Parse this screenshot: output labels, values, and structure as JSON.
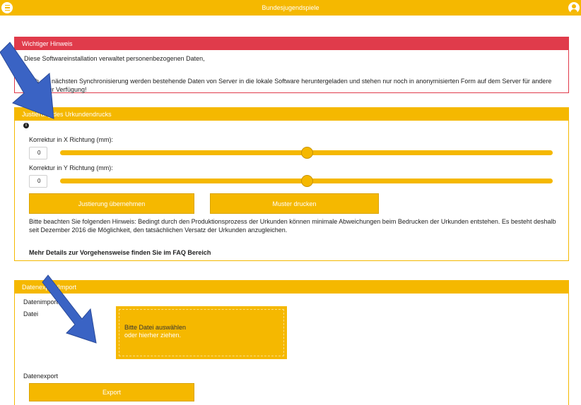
{
  "header": {
    "title": "Bundesjugendspiele"
  },
  "notice": {
    "title": "Wichtiger Hinweis",
    "line1": "Diese Softwareinstallation verwaltet personenbezogenen Daten,",
    "line2": "Nach der nächsten Synchronisierung werden bestehende Daten von Server in die lokale Software heruntergeladen und stehen nur noch in anonymisierten Form auf dem Server für andere Geräte zur Verfügung!"
  },
  "adjustment": {
    "title": "Justierung des Urkundendrucks",
    "x_label": "Korrektur in X Richtung (mm):",
    "x_value": "0",
    "x_slider_fraction": 0.5,
    "y_label": "Korrektur in Y Richtung (mm):",
    "y_value": "0",
    "y_slider_fraction": 0.5,
    "apply_button": "Justierung übernehmen",
    "print_button": "Muster drucken",
    "hint": "Bitte beachten Sie folgenden Hinweis: Bedingt durch den Produktionsprozess der Urkunden können minimale Abweichungen beim Bedrucken der Urkunden entstehen. Es besteht deshalb seit Dezember 2016 die Möglichkeit, den tatsächlichen Versatz der Urkunden anzugleichen.",
    "faq": "Mehr Details zur Vorgehensweise finden Sie im FAQ Bereich"
  },
  "file": {
    "title": "Datenexport/Import",
    "import_label": "Datenimport",
    "file_label": "Datei",
    "drop_line1": "Bitte Datei auswählen",
    "drop_line2": "oder hierher ziehen.",
    "export_label": "Datenexport",
    "export_button": "Export"
  },
  "colors": {
    "accent": "#f5b800",
    "alert": "#e03b4b",
    "arrow": "#3a63c4"
  },
  "icons": {
    "menu": "hamburger-icon",
    "user": "user-icon",
    "info": "info-icon"
  }
}
